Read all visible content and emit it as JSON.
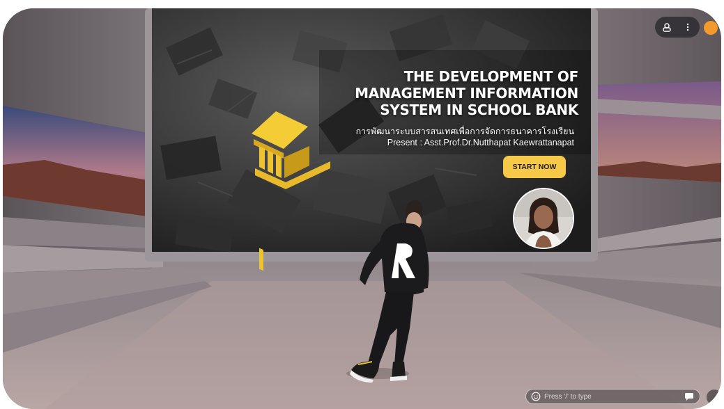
{
  "slide": {
    "title_lines": [
      "THE DEVELOPMENT OF",
      "MANAGEMENT INFORMATION",
      "SYSTEM IN SCHOOL BANK"
    ],
    "thai_subtitle": "การพัฒนาระบบสารสนเทศเพื่อการจัดการธนาคารโรงเรียน",
    "presenter": "Present : Asst.Prof.Dr.Nutthapat Kaewrattanapat",
    "start_button": "START NOW",
    "icon": "bank-building-icon"
  },
  "overlay": {
    "top_buttons": [
      "avatar-icon",
      "more-vertical-icon"
    ],
    "chat": {
      "placeholder": "Press '/' to type",
      "emoji_icon": "smiley-icon",
      "send_icon": "chat-send-icon"
    }
  },
  "colors": {
    "accent": "#f7c948",
    "notch": "#f39a2b",
    "pill": "#28282c"
  }
}
